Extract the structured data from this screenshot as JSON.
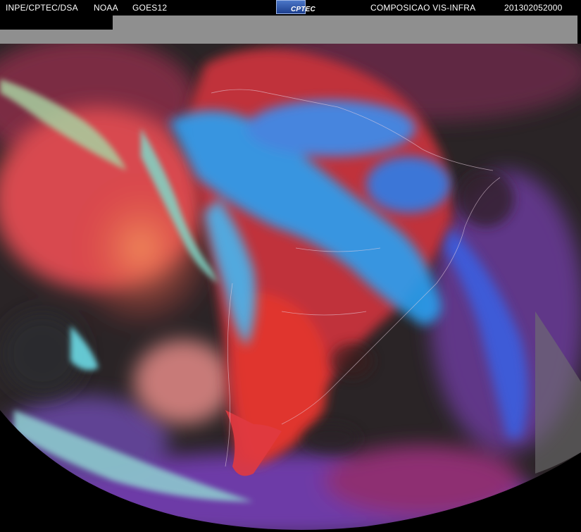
{
  "header": {
    "source": "INPE/CPTEC/DSA",
    "agency": "NOAA",
    "satellite": "GOES12",
    "product": "COMPOSICAO VIS-INFRA",
    "timestamp": "201302052000"
  },
  "logo": {
    "text": "CPTEC"
  },
  "colors": {
    "background": "#000000",
    "space_gray": "#9a9a9a",
    "ocean_dark": "#2a2426",
    "cloud_red": "#d8383e",
    "cloud_blue": "#2aa0f2",
    "cloud_cyan": "#6fe4f0",
    "cloud_purple": "#7a3fbf",
    "cloud_orange": "#e86a50"
  }
}
